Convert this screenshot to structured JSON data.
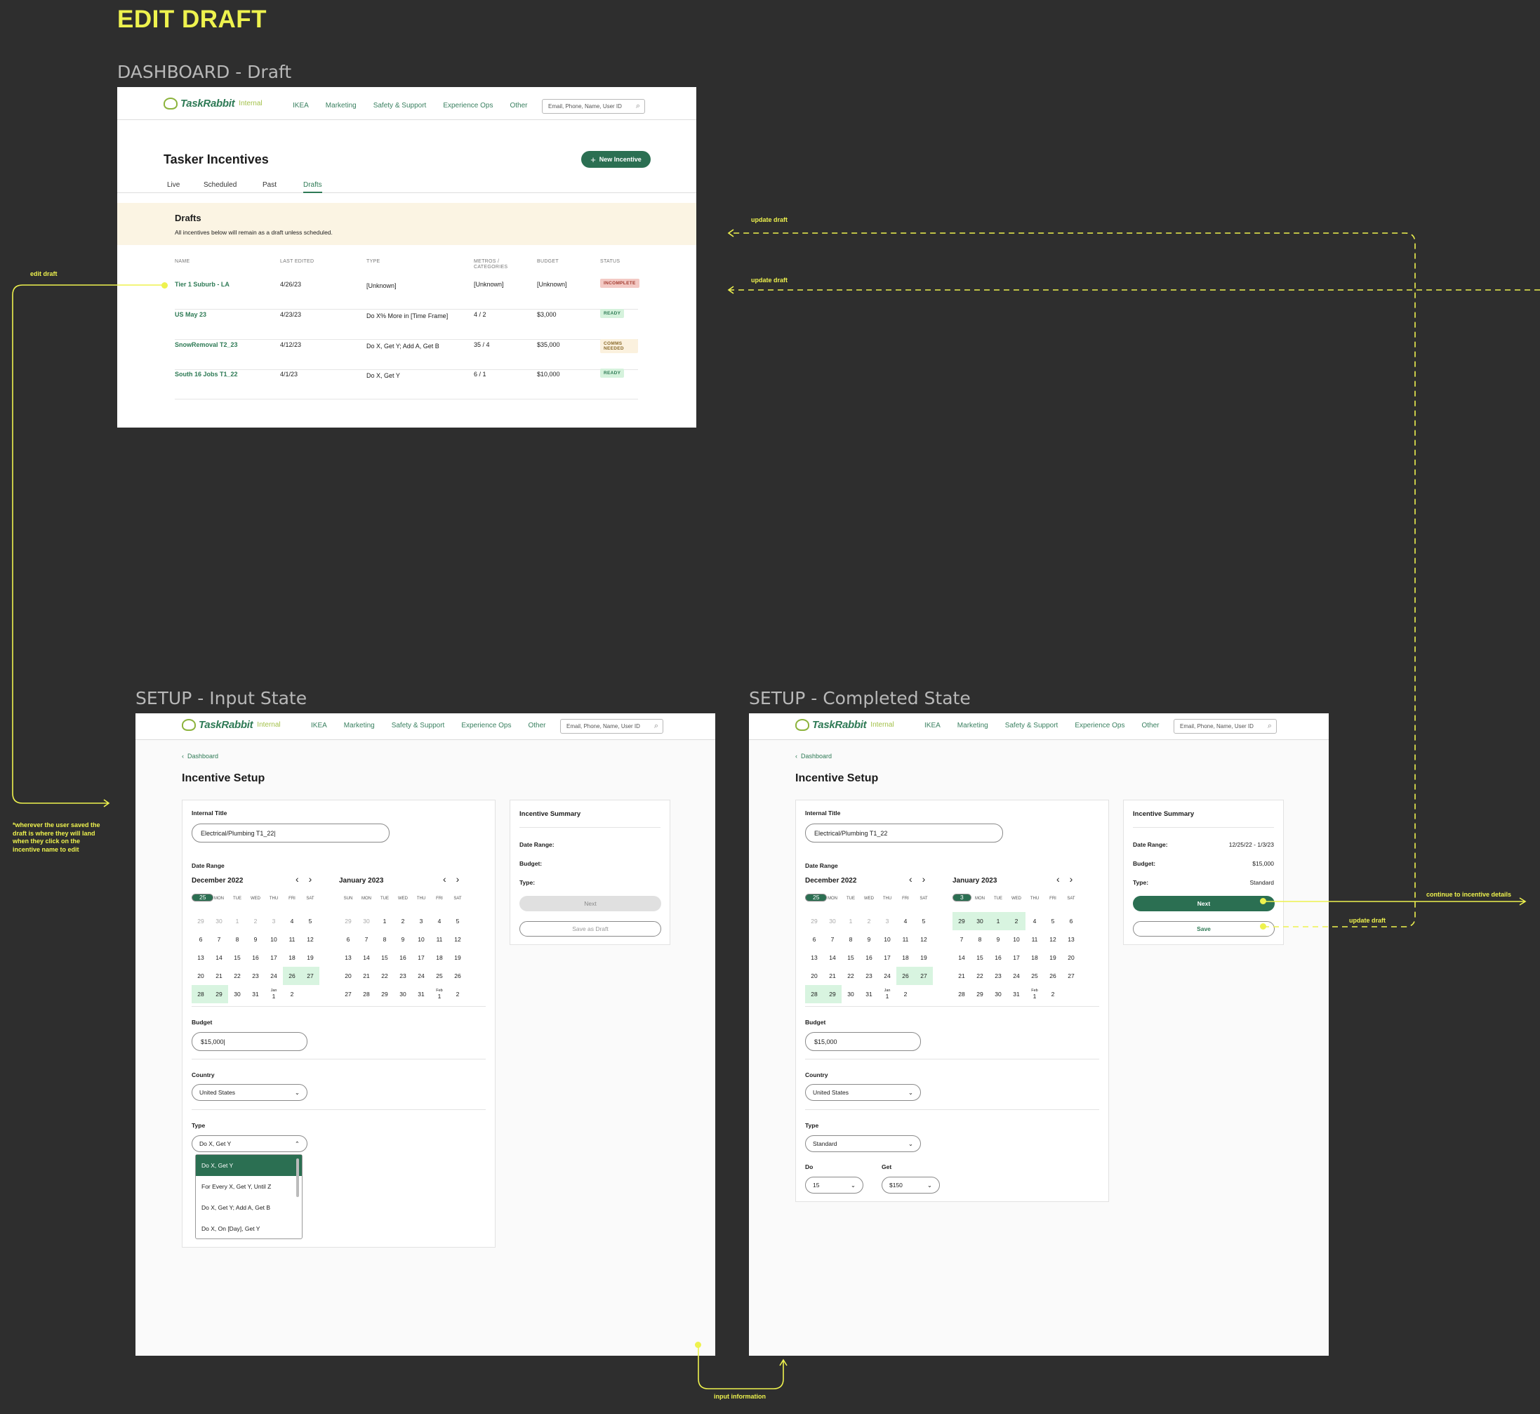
{
  "page_title": "EDIT DRAFT",
  "frames": {
    "dashboard": "DASHBOARD - Draft",
    "setup_input": "SETUP - Input State",
    "setup_completed": "SETUP - Completed State"
  },
  "header": {
    "logo": "TaskRabbit",
    "logo_sub": "Internal",
    "nav": [
      "IKEA",
      "Marketing",
      "Safety & Support",
      "Experience Ops",
      "Other"
    ],
    "search_placeholder": "Email, Phone, Name, User ID"
  },
  "dashboard": {
    "title": "Tasker Incentives",
    "new_button": "New Incentive",
    "tabs": [
      "Live",
      "Scheduled",
      "Past",
      "Drafts"
    ],
    "banner_title": "Drafts",
    "banner_text": "All incentives below will remain as a draft unless scheduled.",
    "columns": [
      "NAME",
      "LAST EDITED",
      "TYPE",
      "METROS / CATEGORIES",
      "BUDGET",
      "STATUS"
    ],
    "rows": [
      {
        "name": "Tier 1 Suburb - LA",
        "edited": "4/26/23",
        "type": "[Unknown]",
        "metros": "[Unknown]",
        "budget": "[Unknown]",
        "status": "INCOMPLETE"
      },
      {
        "name": "US May 23",
        "edited": "4/23/23",
        "type": "Do X% More in [Time Frame]",
        "metros": "4 / 2",
        "budget": "$3,000",
        "status": "READY"
      },
      {
        "name": "SnowRemoval T2_23",
        "edited": "4/12/23",
        "type": "Do X, Get Y; Add A, Get B",
        "metros": "35 / 4",
        "budget": "$35,000",
        "status": "COMMS NEEDED"
      },
      {
        "name": "South 16 Jobs T1_22",
        "edited": "4/1/23",
        "type": "Do X, Get Y",
        "metros": "6 / 1",
        "budget": "$10,000",
        "status": "READY"
      }
    ],
    "status_colors": {
      "INCOMPLETE": "#f3c9c4",
      "READY": "#d5f2dc",
      "COMMS NEEDED": "#fbf1de"
    }
  },
  "setup": {
    "back": "Dashboard",
    "title": "Incentive Setup",
    "internal_title_label": "Internal Title",
    "date_range_label": "Date Range",
    "dow": [
      "SUN",
      "MON",
      "TUE",
      "WED",
      "THU",
      "FRI",
      "SAT"
    ],
    "month1": "December 2022",
    "month2": "January 2023",
    "budget_label": "Budget",
    "country_label": "Country",
    "country": "United States",
    "type_label": "Type",
    "summary_title": "Incentive Summary",
    "sum_date": "Date Range:",
    "sum_budget": "Budget:",
    "sum_type": "Type:"
  },
  "input_state": {
    "internal_title": "Electrical/Plumbing T1_22|",
    "budget": "$15,000|",
    "type": "Do X, Get Y",
    "type_options": [
      "Do X, Get Y",
      "For Every X, Get Y, Until Z",
      "Do X, Get Y; Add A, Get B",
      "Do X, On [Day], Get Y"
    ],
    "next": "Next",
    "save_draft": "Save as Draft"
  },
  "completed_state": {
    "internal_title": "Electrical/Plumbing T1_22",
    "budget": "$15,000",
    "type": "Standard",
    "do_label": "Do",
    "do_value": "15",
    "get_label": "Get",
    "get_value": "$150",
    "sum_date_v": "12/25/22 - 1/3/23",
    "sum_budget_v": "$15,000",
    "sum_type_v": "Standard",
    "next": "Next",
    "save": "Save"
  },
  "annotations": {
    "edit_draft": "edit draft",
    "update_draft": "update draft",
    "input_info": "input information",
    "continue": "continue to incentive details",
    "note": "*wherever the user saved the draft is where they will land when they click on the incentive name to edit"
  },
  "icon_names": [
    "search-icon",
    "plus-icon",
    "chevron-left-icon",
    "chevron-right-icon",
    "chevron-down-icon",
    "chevron-up-icon"
  ],
  "colors": {
    "accent": "#2b6f52",
    "annotation": "#eef24e",
    "background": "#2e2e2e"
  }
}
